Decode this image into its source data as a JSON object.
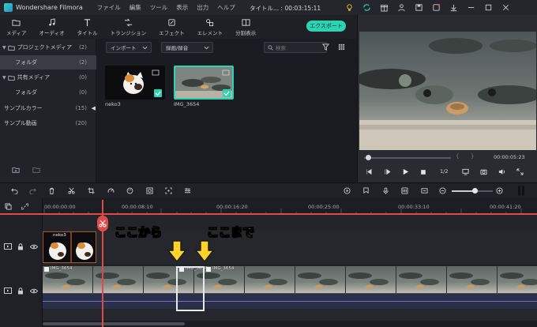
{
  "titlebar": {
    "app_name": "Wondershare Filmora",
    "menu": [
      "ファイル",
      "編集",
      "ツール",
      "表示",
      "出力",
      "ヘルプ"
    ],
    "project_title": "タイトル... : 00:03:15:11"
  },
  "toolbar": {
    "items": [
      {
        "label": "メディア",
        "icon": "folder-icon"
      },
      {
        "label": "オーディオ",
        "icon": "music-note-icon"
      },
      {
        "label": "タイトル",
        "icon": "text-icon"
      },
      {
        "label": "トランジション",
        "icon": "transition-icon"
      },
      {
        "label": "エフェクト",
        "icon": "effects-icon"
      },
      {
        "label": "エレメント",
        "icon": "element-icon"
      },
      {
        "label": "分割表示",
        "icon": "split-screen-icon"
      }
    ],
    "export_label": "エクスポート"
  },
  "tree": {
    "items": [
      {
        "label": "プロジェクトメディア",
        "count": "(2)"
      },
      {
        "label": "フォルダ",
        "count": "(2)"
      },
      {
        "label": "共有メディア",
        "count": "(0)"
      },
      {
        "label": "フォルダ",
        "count": "(0)"
      },
      {
        "label": "サンプルカラー",
        "count": "(15)"
      },
      {
        "label": "サンプル動画",
        "count": "(20)"
      }
    ]
  },
  "media": {
    "import_label": "インポート",
    "record_label": "録画/録音",
    "search_placeholder": "検索",
    "thumbs": [
      {
        "label": "neko3"
      },
      {
        "label": "IMG_3654"
      }
    ]
  },
  "preview": {
    "timecode": "00:00:05:23",
    "speed": "1/2"
  },
  "timeline": {
    "ruler": [
      "00:00:00:00",
      "00:00:08:10",
      "00:00:16:20",
      "00:00:25:00",
      "00:00:33:10",
      "00:00:41:20"
    ],
    "clips": [
      {
        "label": "neko3"
      },
      {
        "label": "IMG_3654"
      },
      {
        "label": "IMG_3654"
      },
      {
        "label": "IMG_3654"
      }
    ],
    "annotations": {
      "from": "ここから",
      "to": "ここまで"
    },
    "colors": {
      "playhead": "#e04a4a",
      "annotation": "#ffd32a",
      "accent": "#2bd3b0"
    }
  }
}
